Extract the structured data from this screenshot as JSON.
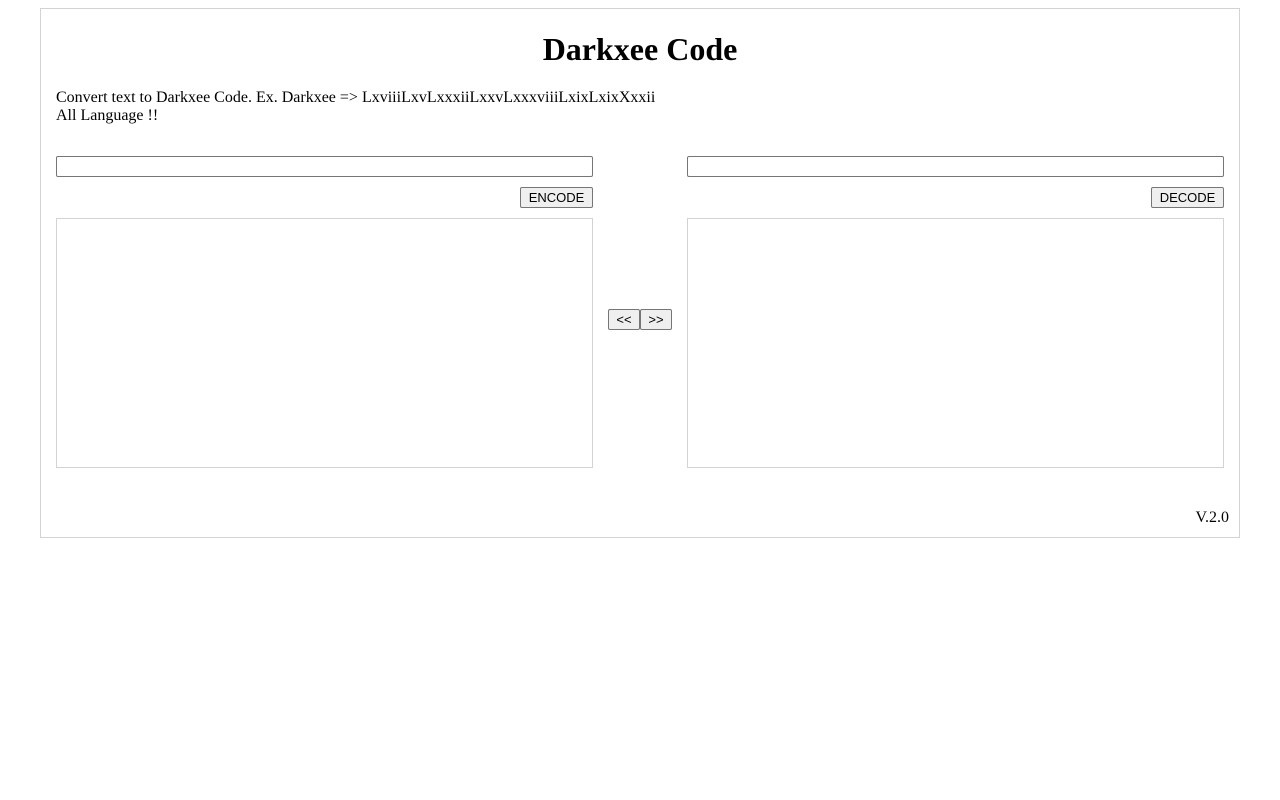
{
  "app": {
    "title": "Darkxee Code",
    "description_line1": "Convert text to Darkxee Code. Ex. Darkxee => LxviiiLxvLxxxiiLxxvLxxxviiiLxixLxixXxxii",
    "description_line2": "All Language !!",
    "version": "V.2.0"
  },
  "encoder": {
    "input_value": "",
    "button_label": "ENCODE",
    "output_value": ""
  },
  "decoder": {
    "input_value": "",
    "button_label": "DECODE",
    "output_value": ""
  },
  "transfer": {
    "to_left_label": "<<",
    "to_right_label": ">>"
  },
  "colors": {
    "border": "#d3d3d3",
    "button_bg": "#efefef",
    "input_border": "#767676"
  }
}
